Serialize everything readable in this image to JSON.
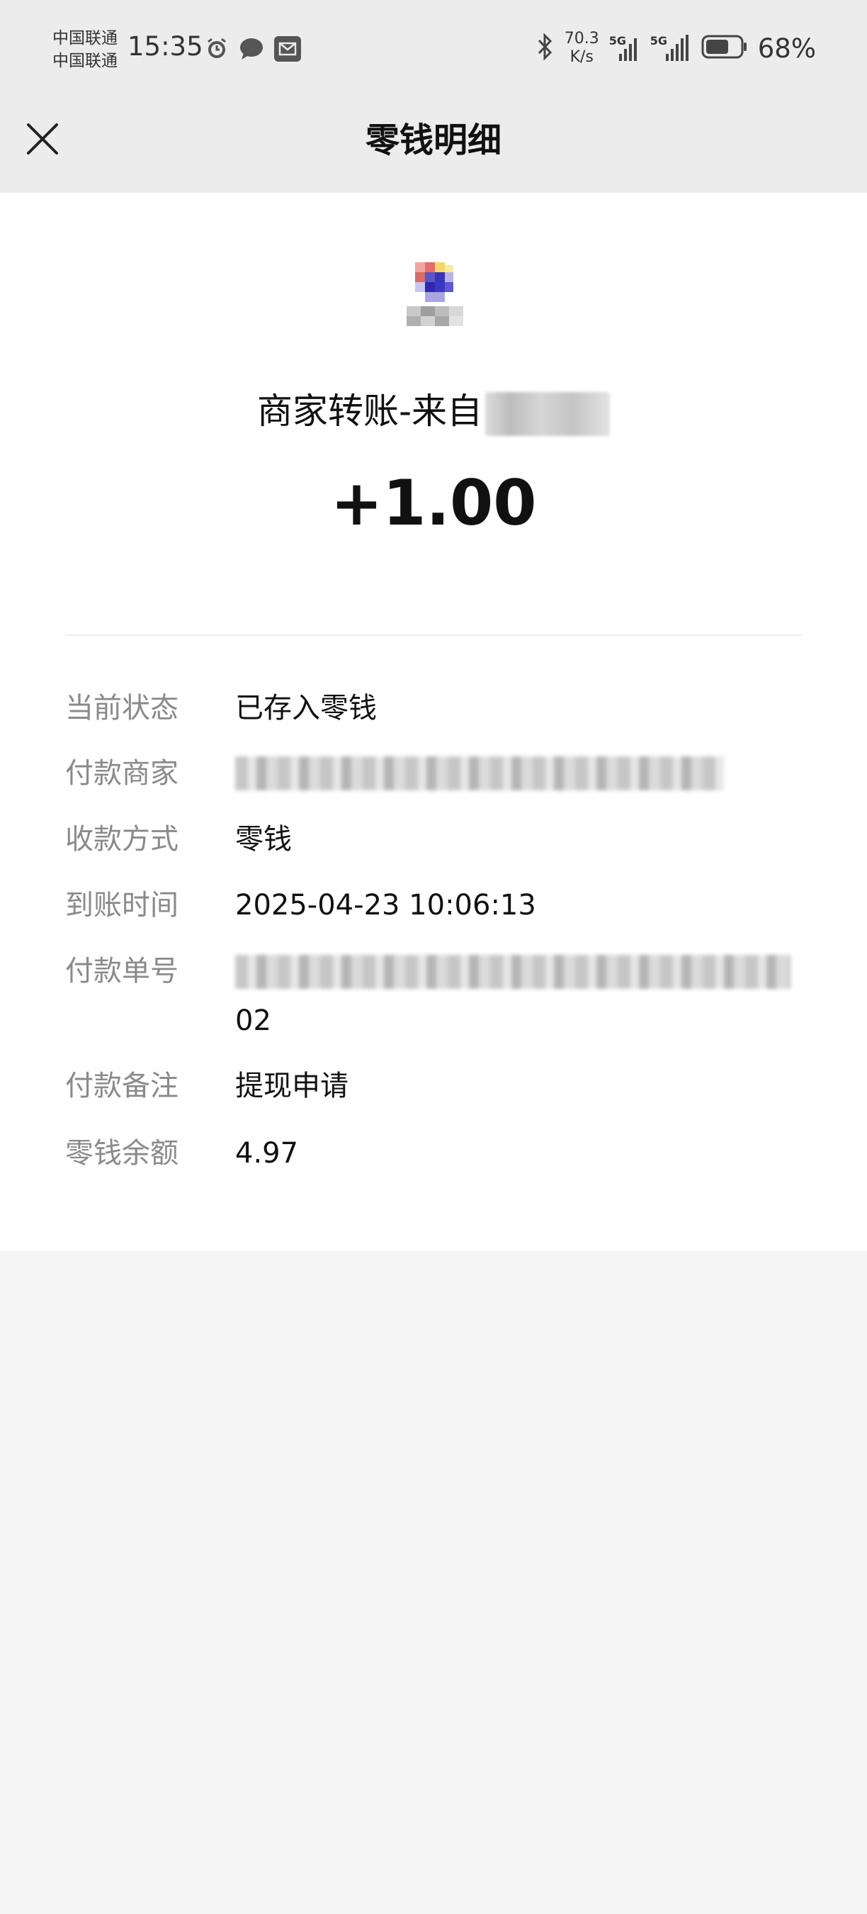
{
  "status_bar": {
    "carrier_1": "中国联通",
    "carrier_2": "中国联通",
    "time": "15:35",
    "net_speed_value": "70.3",
    "net_speed_unit": "K/s",
    "signal_1_label": "5G",
    "signal_2_label": "5G",
    "battery_percent": "68%",
    "battery_level": 0.68,
    "icons": [
      "alarm-icon",
      "chat-bubble-icon",
      "mail-icon",
      "bluetooth-icon",
      "signal-icon",
      "battery-icon"
    ]
  },
  "header": {
    "title": "零钱明细",
    "close_icon": "close-icon"
  },
  "summary": {
    "merchant_title_prefix": "商家转账-来自",
    "amount": "+1.00"
  },
  "details": {
    "status_label": "当前状态",
    "status_value": "已存入零钱",
    "payer_label": "付款商家",
    "method_label": "收款方式",
    "method_value": "零钱",
    "time_label": "到账时间",
    "time_value": "2025-04-23 10:06:13",
    "order_label": "付款单号",
    "order_value_tail": "02",
    "remark_label": "付款备注",
    "remark_value": "提现申请",
    "balance_label": "零钱余额",
    "balance_value": "4.97"
  },
  "colors": {
    "page_bg": "#f5f5f5",
    "header_bg": "#ececec",
    "card_bg": "#ffffff",
    "label_gray": "#8a8a8a",
    "text": "#111111"
  }
}
